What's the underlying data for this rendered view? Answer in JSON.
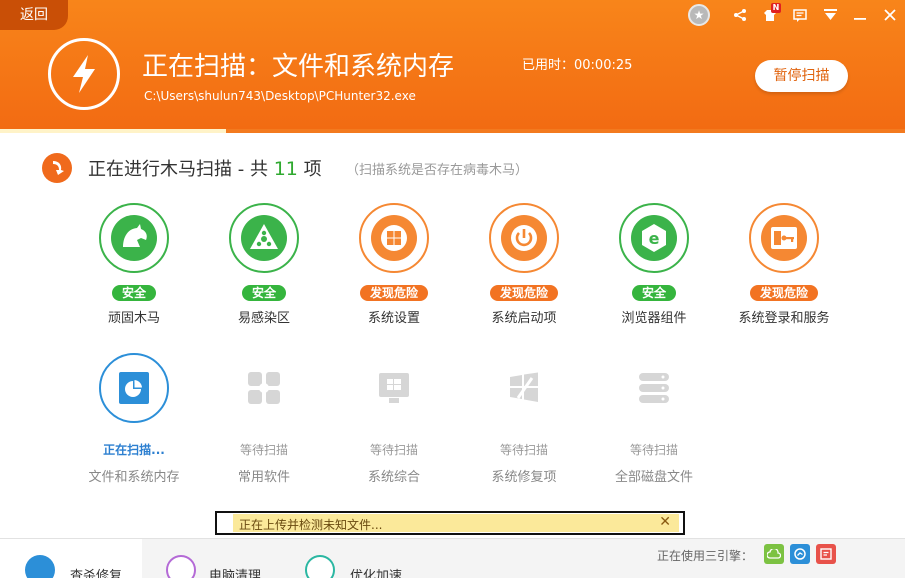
{
  "header": {
    "back_label": "返回",
    "scan_title": "正在扫描：文件和系统内存",
    "scan_path": "C:\\Users\\shulun743\\Desktop\\PCHunter32.exe",
    "elapsed": "已用时：00:00:25",
    "pause_label": "暂停扫描",
    "notification_badge": "N",
    "progress_fraction": 0.25
  },
  "section": {
    "title_prefix": "正在进行木马扫描 - 共",
    "count": "11",
    "title_suffix": "项",
    "hint": "（扫描系统是否存在病毒木马）"
  },
  "scan_items_row1": [
    {
      "label": "顽固木马",
      "status": "安全",
      "icon": "horse-icon"
    },
    {
      "label": "易感染区",
      "status": "安全",
      "icon": "warning-triangle-icon"
    },
    {
      "label": "系统设置",
      "status": "发现危险",
      "icon": "windows-gear-icon"
    },
    {
      "label": "系统启动项",
      "status": "发现危险",
      "icon": "power-icon"
    },
    {
      "label": "浏览器组件",
      "status": "安全",
      "icon": "ie-browser-icon"
    },
    {
      "label": "系统登录和服务",
      "status": "发现危险",
      "icon": "login-service-icon"
    }
  ],
  "scan_items_row2": [
    {
      "label": "文件和系统内存",
      "status": "正在扫描...",
      "icon": "memory-chart-icon"
    },
    {
      "label": "常用软件",
      "status": "等待扫描",
      "icon": "apps-icon"
    },
    {
      "label": "系统综合",
      "status": "等待扫描",
      "icon": "windows-monitor-icon"
    },
    {
      "label": "系统修复项",
      "status": "等待扫描",
      "icon": "windows-repair-icon"
    },
    {
      "label": "全部磁盘文件",
      "status": "等待扫描",
      "icon": "disk-stack-icon"
    }
  ],
  "notice": {
    "text": "正在上传并检测未知文件...",
    "close": "✕"
  },
  "bottom": {
    "tabs": [
      {
        "label": "查杀修复",
        "icon": "bolt-icon"
      },
      {
        "label": "电脑清理",
        "icon": "broom-icon"
      },
      {
        "label": "优化加速",
        "icon": "rocket-icon"
      }
    ],
    "engine_label": "正在使用三引擎："
  },
  "colors": {
    "header_orange": "#f26a12",
    "safe_green": "#35b53d",
    "danger_orange": "#f27322",
    "active_blue": "#2c7fd0"
  }
}
